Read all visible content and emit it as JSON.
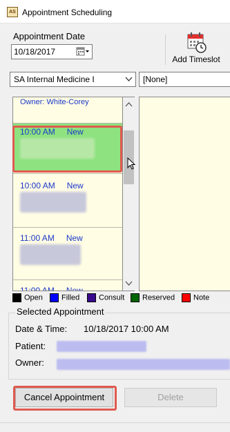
{
  "window": {
    "title": "Appointment Scheduling",
    "icon": "app-calendar-icon"
  },
  "date_section": {
    "label": "Appointment Date",
    "value": "10/18/2017",
    "picker_icon": "calendar-dropdown-icon"
  },
  "toolbar": {
    "add_timeslot_label": "Add Timeslot",
    "add_timeslot_icon": "calendar-clock-icon"
  },
  "filters": {
    "department": "SA Internal Medicine I",
    "secondary": "[None]"
  },
  "schedule": {
    "owner_label": "Owner: White-Corey",
    "slots": [
      {
        "time": "10:00 AM",
        "status": "New",
        "selected": true
      },
      {
        "time": "10:00 AM",
        "status": "New",
        "selected": false
      },
      {
        "time": "11:00 AM",
        "status": "New",
        "selected": false
      },
      {
        "time": "11:00 AM",
        "status": "New",
        "selected": false
      }
    ]
  },
  "legend": [
    {
      "label": "Open",
      "color": "#000000"
    },
    {
      "label": "Filled",
      "color": "#0000ff"
    },
    {
      "label": "Consult",
      "color": "#3a0a8c"
    },
    {
      "label": "Reserved",
      "color": "#006400"
    },
    {
      "label": "Note",
      "color": "#ff0000"
    }
  ],
  "selected_appointment": {
    "title": "Selected Appointment",
    "datetime_label": "Date & Time:",
    "datetime_value": "10/18/2017 10:00 AM",
    "patient_label": "Patient:",
    "owner_label": "Owner:"
  },
  "buttons": {
    "cancel_label": "Cancel Appointment",
    "delete_label": "Delete"
  },
  "colors": {
    "selected_slot": "#8ee280",
    "schedule_bg": "#fffde4",
    "link_blue": "#1b38c9",
    "highlight": "#e05a4e"
  }
}
